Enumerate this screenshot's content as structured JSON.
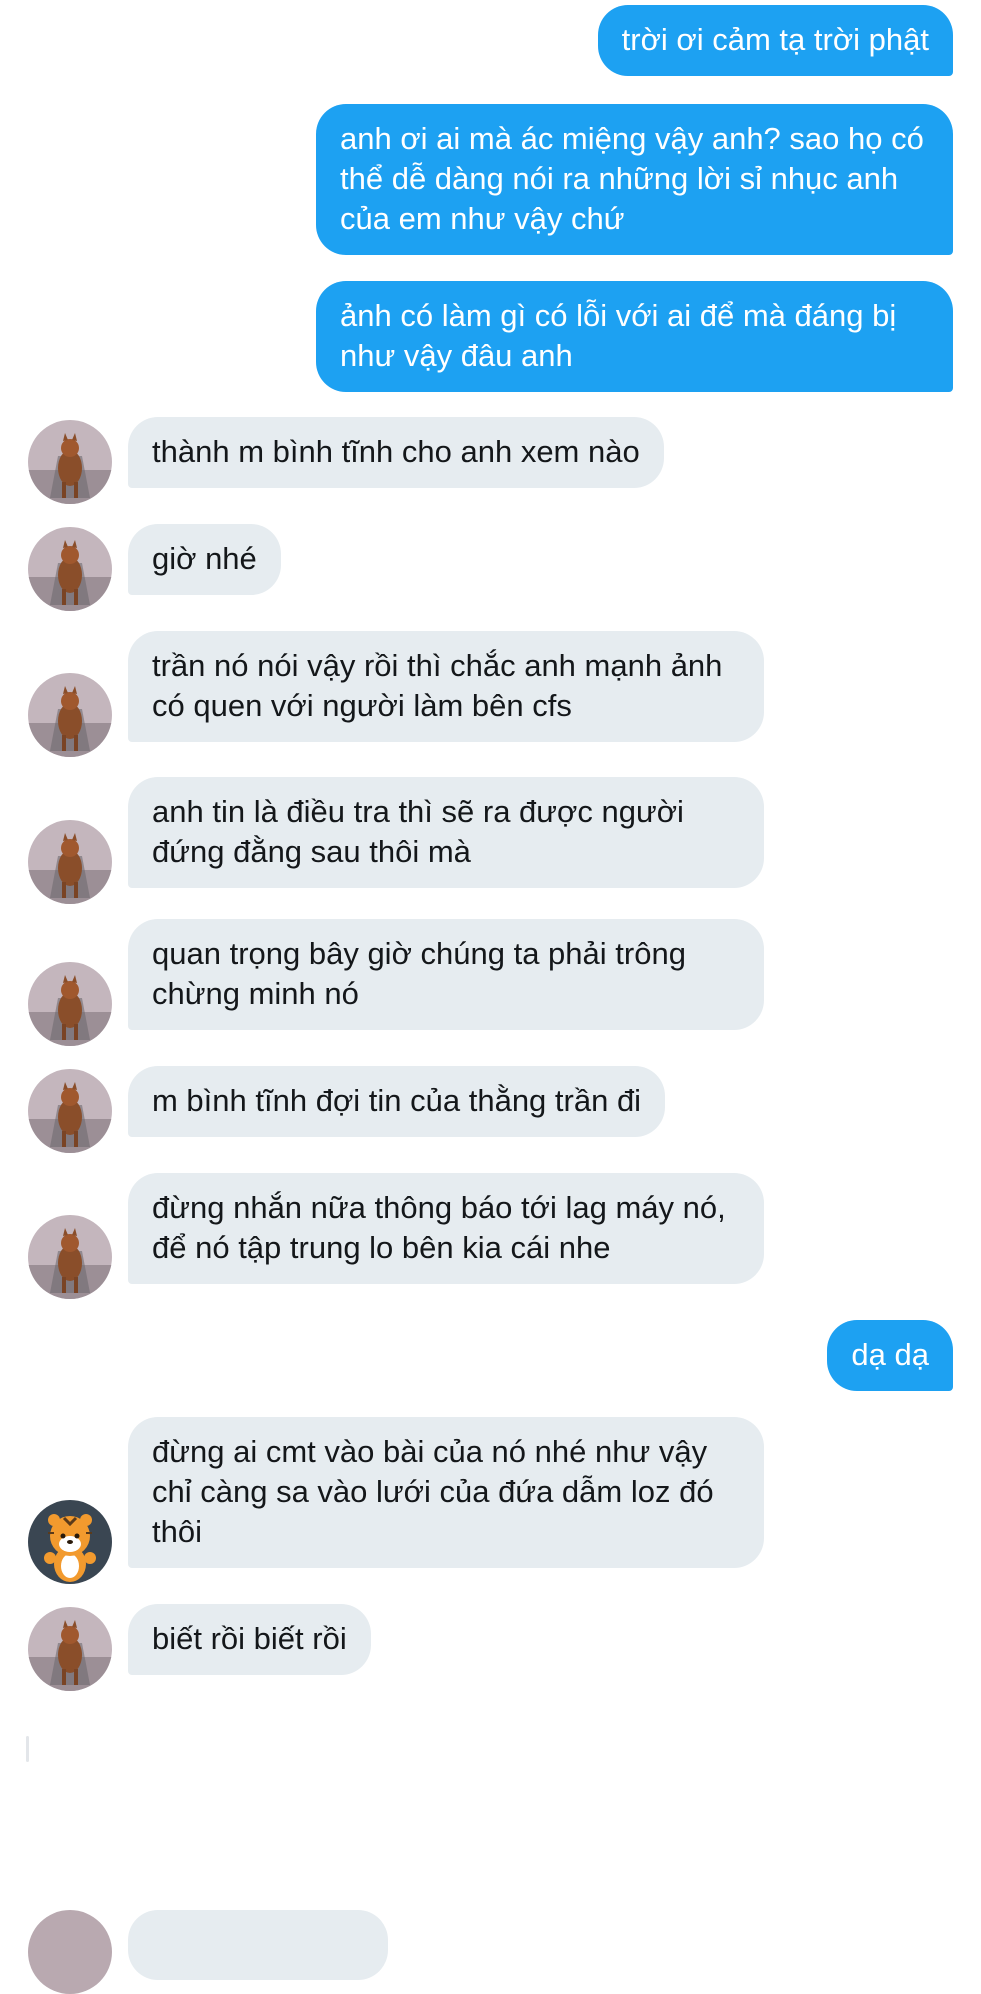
{
  "messages": [
    {
      "from": "me",
      "text": "trời ơi cảm tạ trời phật"
    },
    {
      "from": "me",
      "text": "anh ơi ai mà ác miệng vậy anh? sao họ có thể dễ dàng nói ra những lời sỉ nhục anh của em như vậy chứ"
    },
    {
      "from": "me",
      "text": "ảnh có làm gì có lỗi với ai để mà đáng bị như vậy đâu anh"
    },
    {
      "from": "them",
      "avatar": "cat-avatar",
      "text": "thành m bình tĩnh cho anh xem nào"
    },
    {
      "from": "them",
      "avatar": "cat-avatar",
      "text": "giờ nhé"
    },
    {
      "from": "them",
      "avatar": "cat-avatar",
      "text": "trần nó nói vậy rồi thì chắc anh mạnh ảnh có quen với người làm bên cfs"
    },
    {
      "from": "them",
      "avatar": "cat-avatar",
      "text": "anh tin là điều tra thì sẽ ra được người đứng đằng sau thôi mà"
    },
    {
      "from": "them",
      "avatar": "cat-avatar",
      "text": "quan trọng bây giờ chúng ta phải trông chừng minh nó"
    },
    {
      "from": "them",
      "avatar": "cat-avatar",
      "text": "m bình tĩnh đợi tin của thằng trần đi"
    },
    {
      "from": "them",
      "avatar": "cat-avatar",
      "text": "đừng nhắn nữa thông báo tới lag máy nó, để nó tập trung lo bên kia cái nhe"
    },
    {
      "from": "me",
      "text": "dạ dạ"
    },
    {
      "from": "them",
      "avatar": "tiger-avatar",
      "text": "đừng ai cmt vào bài của nó nhé như vậy chỉ càng sa vào lưới của đứa dẫm loz đó thôi"
    },
    {
      "from": "them",
      "avatar": "cat-avatar",
      "text": "biết rồi biết rồi"
    }
  ],
  "colors": {
    "outgoing_bubble": "#1da1f2",
    "incoming_bubble": "#e6ecf0",
    "outgoing_text": "#ffffff",
    "incoming_text": "#14171a"
  }
}
